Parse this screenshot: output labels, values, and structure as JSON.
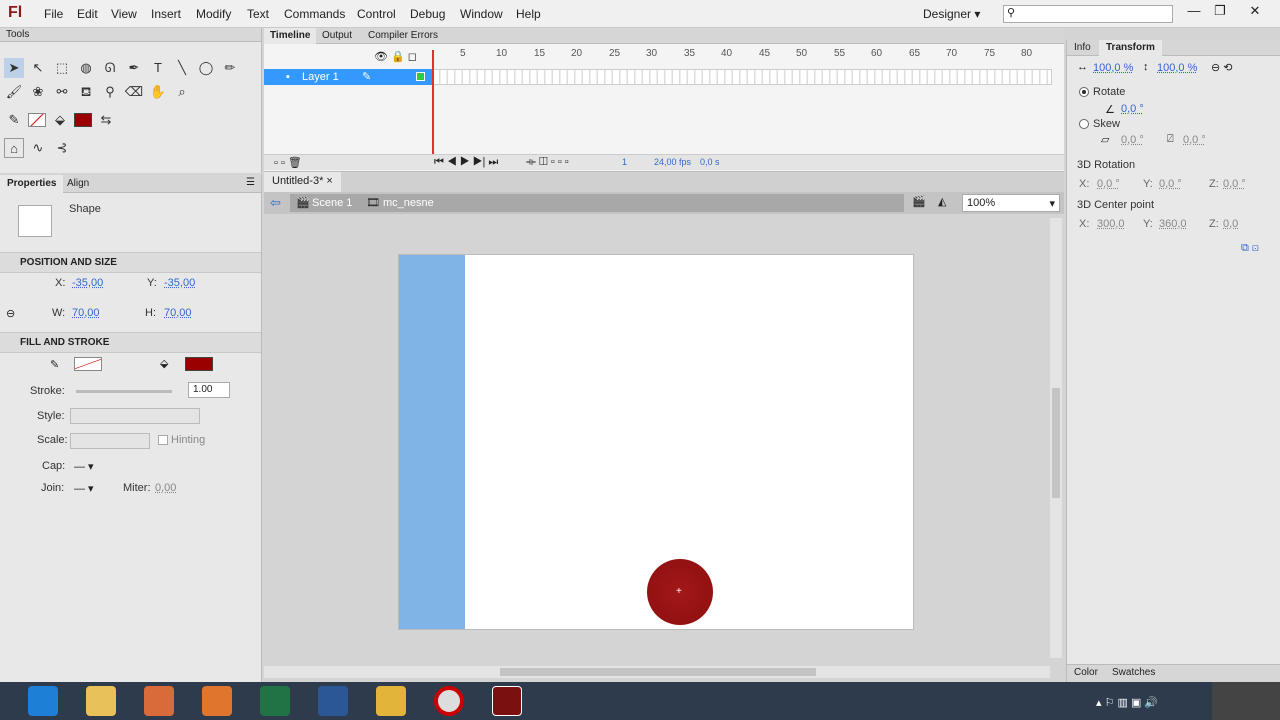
{
  "app": {
    "logo": "Fl"
  },
  "menu": [
    "File",
    "Edit",
    "View",
    "Insert",
    "Modify",
    "Text",
    "Commands",
    "Control",
    "Debug",
    "Window",
    "Help"
  ],
  "workspace": {
    "label": "Designer"
  },
  "window_buttons": {
    "minimize": "—",
    "maximize": "❐",
    "close": "✕"
  },
  "tools": {
    "title": "Tools"
  },
  "timeline": {
    "tabs": [
      "Timeline",
      "Output",
      "Compiler Errors"
    ],
    "ruler": [
      "5",
      "10",
      "15",
      "20",
      "25",
      "30",
      "35",
      "40",
      "45",
      "50",
      "55",
      "60",
      "65",
      "70",
      "75",
      "80"
    ],
    "layer_name": "Layer 1",
    "current_frame": "1",
    "fps": "24,00 fps",
    "time": "0,0 s"
  },
  "document": {
    "tab": "Untitled-3*",
    "scene": "Scene 1",
    "symbol": "mc_nesne",
    "zoom": "100%"
  },
  "properties": {
    "tabs": [
      "Properties",
      "Align"
    ],
    "object_type": "Shape",
    "pos_section": "POSITION AND SIZE",
    "x_label": "X:",
    "x": "-35,00",
    "y_label": "Y:",
    "y": "-35,00",
    "w_label": "W:",
    "w": "70,00",
    "h_label": "H:",
    "h": "70,00",
    "fill_section": "FILL AND STROKE",
    "fill_color": "#990000",
    "stroke_label": "Stroke:",
    "stroke_value": "1.00",
    "style_label": "Style:",
    "scale_label": "Scale:",
    "hinting_label": "Hinting",
    "cap_label": "Cap:",
    "join_label": "Join:",
    "miter_label": "Miter:",
    "miter_value": "0,00"
  },
  "transform": {
    "tabs": [
      "Info",
      "Transform"
    ],
    "scale_w": "100,0 %",
    "scale_h": "100,0 %",
    "rotate_label": "Rotate",
    "rotate_value": "0,0 °",
    "skew_label": "Skew",
    "skew_h": "0,0 °",
    "skew_v": "0,0 °",
    "rot3d_label": "3D Rotation",
    "rot3d_x": "0,0 °",
    "rot3d_y": "0,0 °",
    "rot3d_z": "0,0 °",
    "center_label": "3D Center point",
    "center_x": "300,0",
    "center_y": "360,0",
    "center_z": "0,0"
  },
  "bottom_tabs": [
    "Color",
    "Swatches"
  ],
  "colors": {
    "stage_rect": "#80b3e6",
    "circle": "#990000",
    "accent": "#3399ff"
  }
}
